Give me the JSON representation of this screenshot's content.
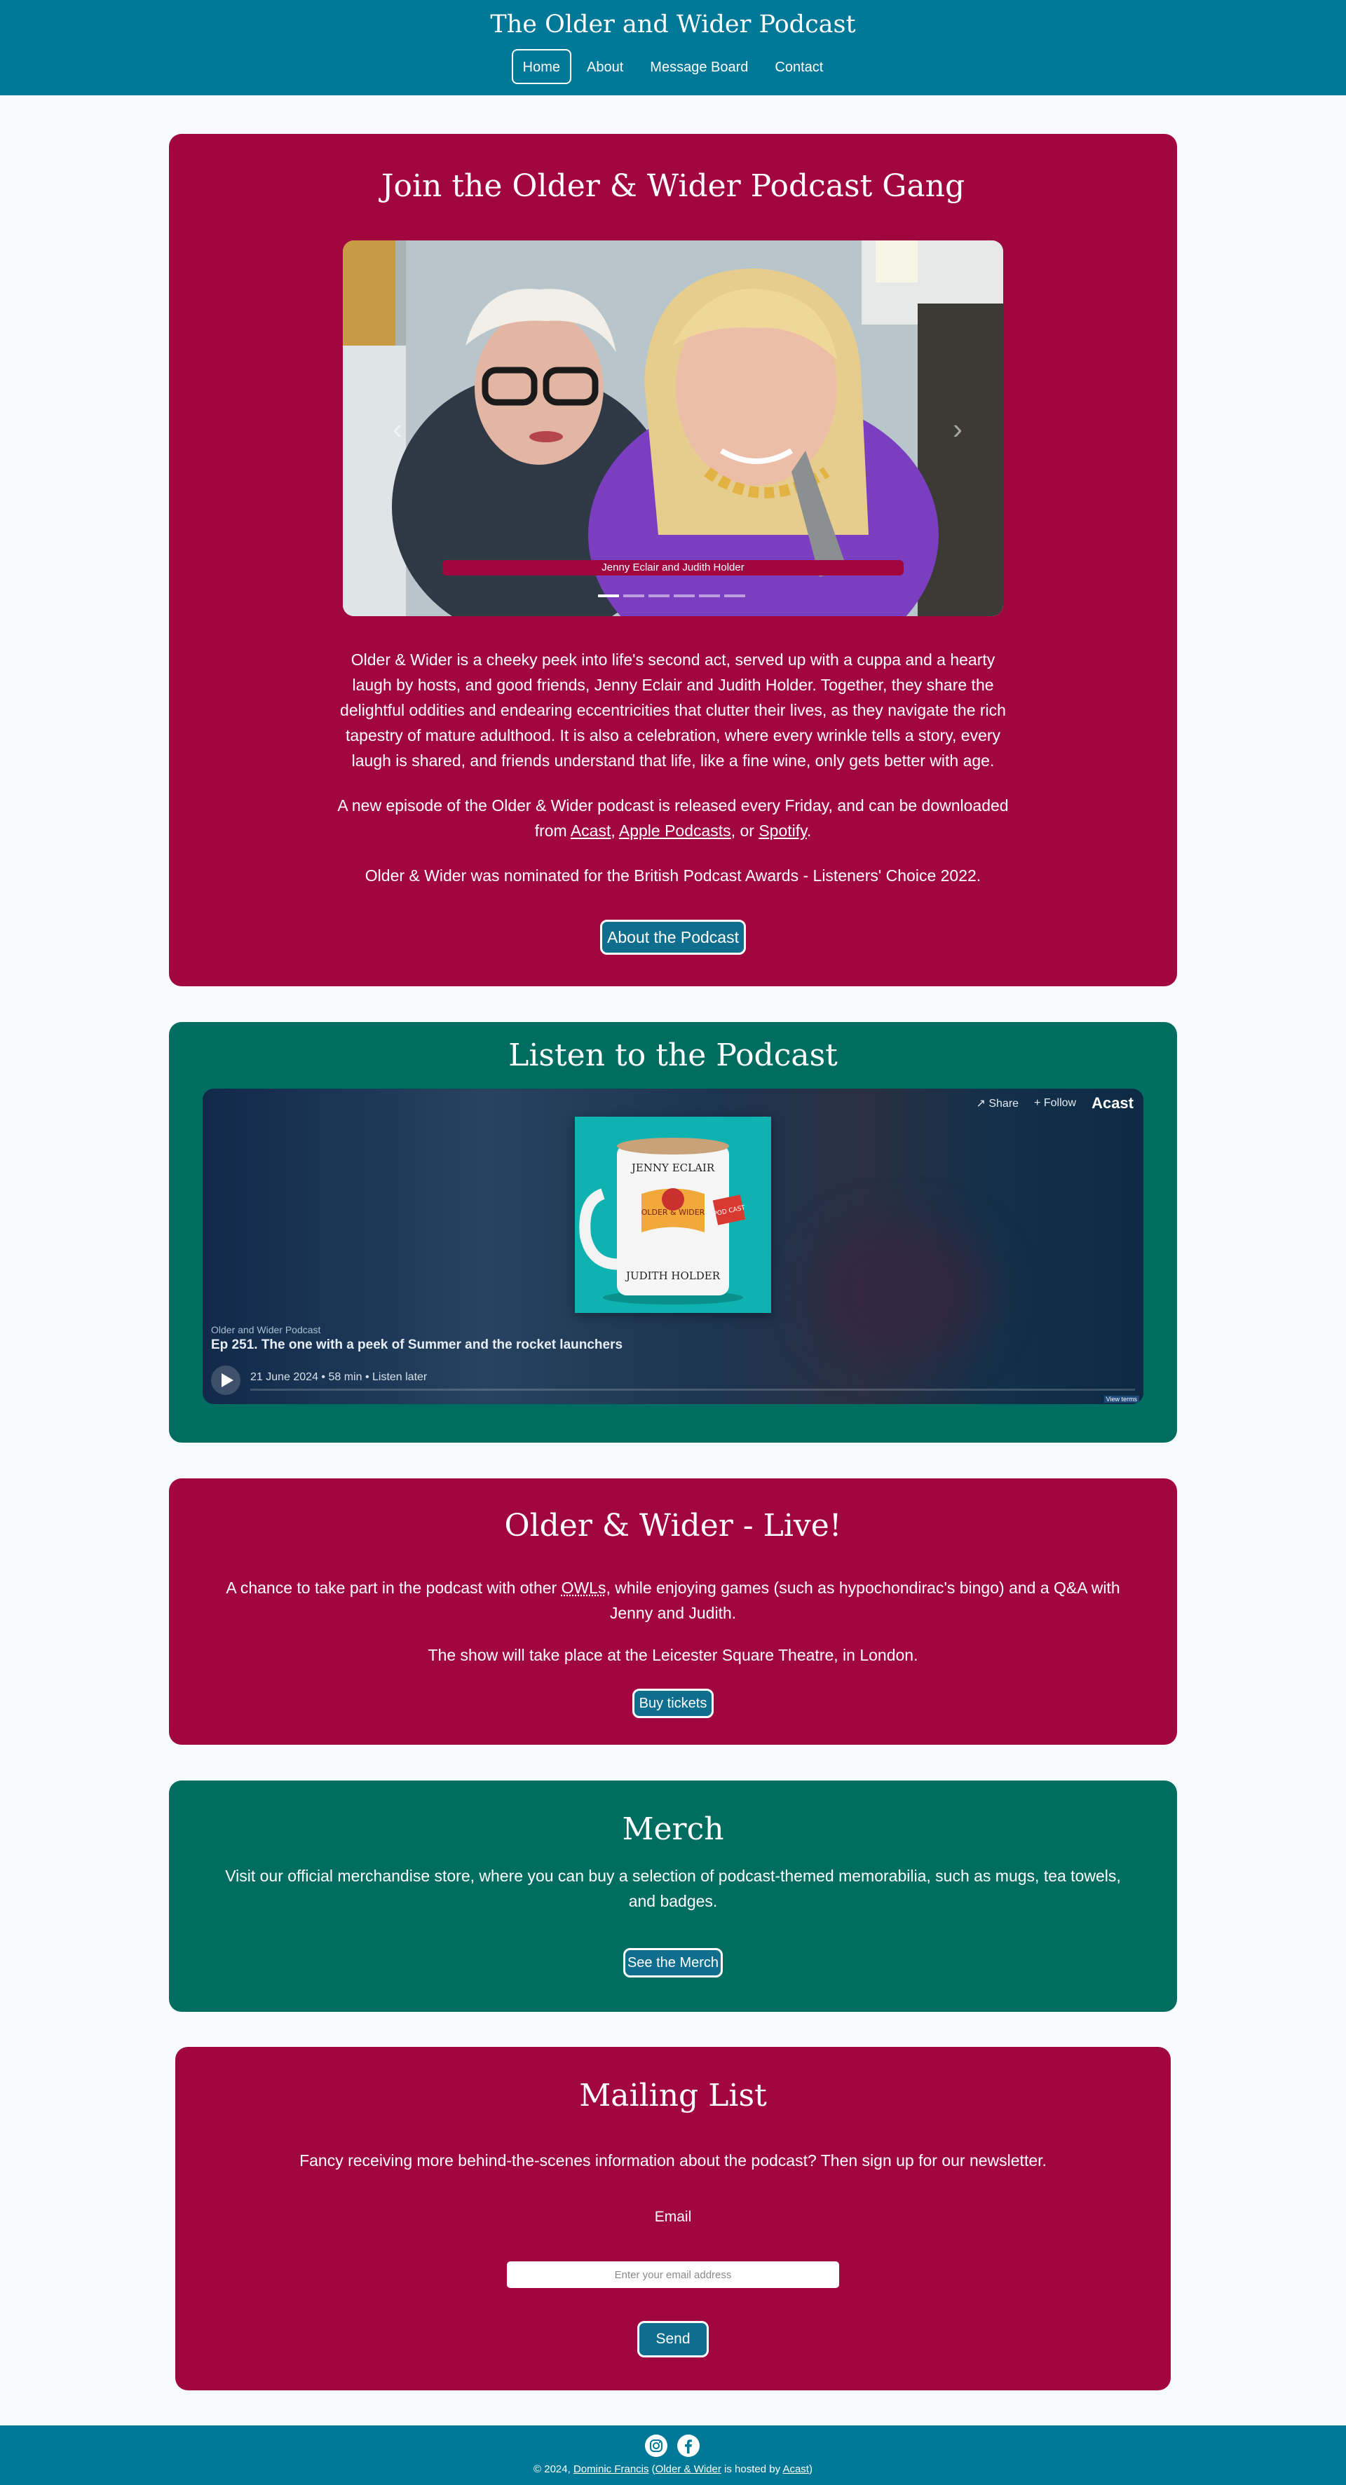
{
  "site": {
    "title": "The Older and Wider Podcast"
  },
  "nav": {
    "items": [
      "Home",
      "About",
      "Message Board",
      "Contact"
    ],
    "active": "Home"
  },
  "hero": {
    "heading": "Join the Older & Wider Podcast Gang",
    "carousel": {
      "caption": "Jenny Eclair and Judith Holder",
      "slide_count": 6,
      "active_slide": 1
    },
    "paragraph1": "Older & Wider is a cheeky peek into life's second act, served up with a cuppa and a hearty laugh by hosts, and good friends, Jenny Eclair and Judith Holder. Together, they share the delightful oddities and endearing eccentricities that clutter their lives, as they navigate the rich tapestry of mature adulthood. It is also a celebration, where every wrinkle tells a story, every laugh is shared, and friends understand that life, like a fine wine, only gets better with age.",
    "paragraph2_prefix": "A new episode of the Older & Wider podcast is released every Friday, and can be downloaded from ",
    "link_acast": "Acast",
    "sep1": ", ",
    "link_apple": "Apple Podcasts",
    "sep2": ", or ",
    "link_spotify": "Spotify",
    "paragraph2_suffix": ".",
    "paragraph3": "Older & Wider was nominated for the British Podcast Awards - Listeners' Choice 2022.",
    "button": "About the Podcast"
  },
  "listen": {
    "heading": "Listen to the Podcast",
    "player": {
      "share": "Share",
      "follow": "+ Follow",
      "brand": "Acast",
      "show_name": "Older and Wider Podcast",
      "episode_title": "Ep 251. The one with a peek of Summer and the rocket launchers",
      "meta": "21 June 2024 • 58 min • Listen later",
      "terms": "View terms",
      "cover": {
        "top_text": "JENNY ECLAIR",
        "banner": "OLDER & WIDER",
        "badge": "POD CAST",
        "bottom_text": "JUDITH HOLDER"
      }
    }
  },
  "live": {
    "heading": "Older & Wider - Live!",
    "text_before": "A chance to take part in the podcast with other ",
    "abbr": "OWLs",
    "text_after": ", while enjoying games (such as hypochondirac's bingo) and a Q&A with Jenny and Judith.",
    "paragraph2": "The show will take place at the Leicester Square Theatre, in London.",
    "button": "Buy tickets"
  },
  "merch": {
    "heading": "Merch",
    "paragraph": "Visit our official merchandise store, where you can buy a selection of podcast-themed memorabilia, such as mugs, tea towels, and badges.",
    "button": "See the Merch"
  },
  "mailing": {
    "heading": "Mailing List",
    "paragraph": "Fancy receiving more behind-the-scenes information about the podcast? Then sign up for our newsletter.",
    "email_label": "Email",
    "email_placeholder": "Enter your email address",
    "email_value": "",
    "button": "Send"
  },
  "footer": {
    "copyright": "© 2024, ",
    "author": "Dominic Francis",
    "open": " (",
    "site_link": "Older & Wider",
    "hosted": " is hosted by ",
    "host_link": "Acast",
    "close": ")",
    "icons": [
      "instagram-icon",
      "facebook-icon"
    ]
  },
  "colors": {
    "header": "#007898",
    "maroon": "#a1063e",
    "green": "#016d61",
    "button": "#0f6e8d"
  }
}
